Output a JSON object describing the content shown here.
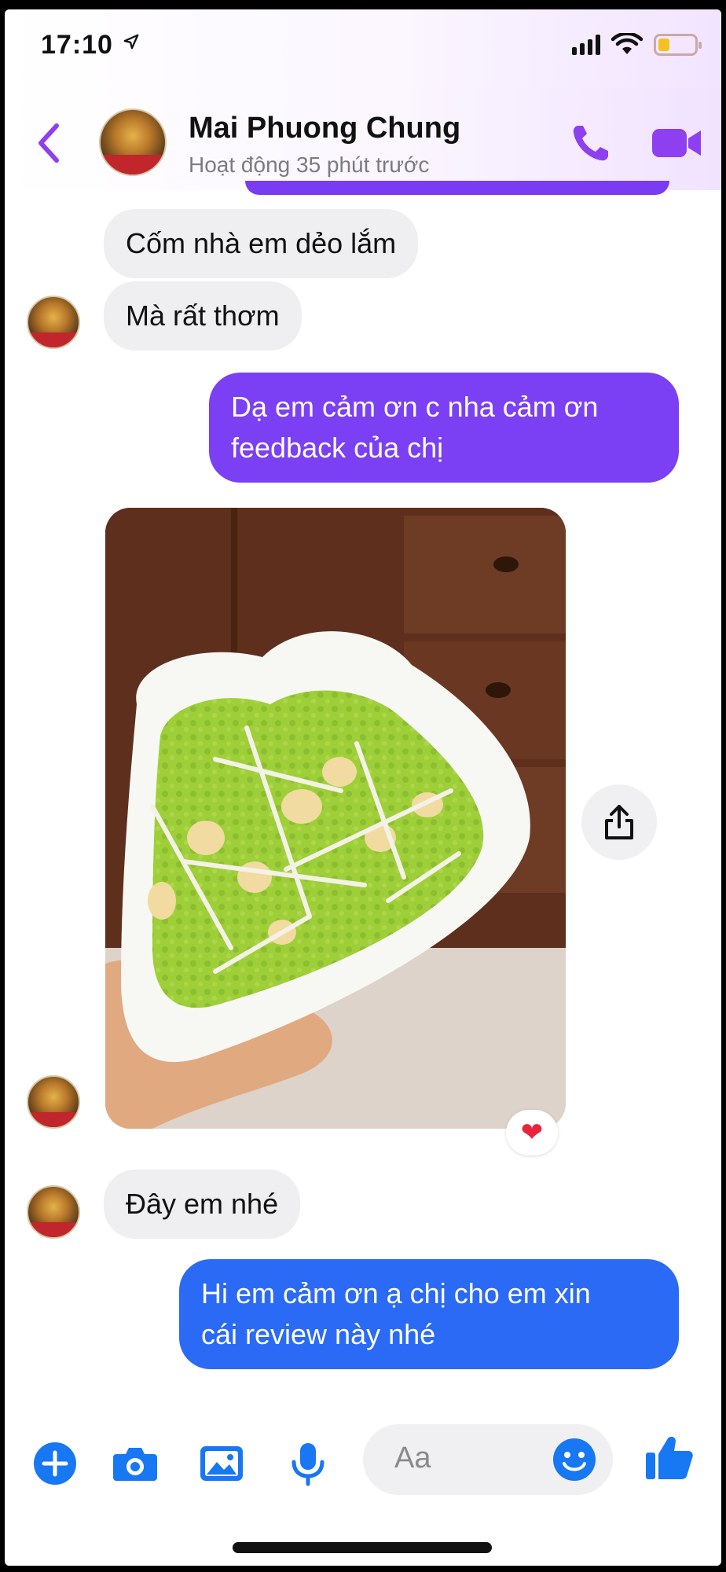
{
  "status_bar": {
    "time": "17:10"
  },
  "header": {
    "contact_name": "Mai Phuong Chung",
    "activity_status": "Hoạt động 35 phút trước"
  },
  "messages": [
    {
      "from": "contact",
      "text": "Cốm nhà em dẻo lắm"
    },
    {
      "from": "contact",
      "text": "Mà rất thơm"
    },
    {
      "from": "me",
      "line1": "Dạ em cảm ơn c nha cảm ơn",
      "line2": "feedback của chị"
    },
    {
      "from": "contact",
      "type": "photo",
      "reaction": "❤"
    },
    {
      "from": "contact",
      "text": "Đây em nhé"
    },
    {
      "from": "me",
      "line1": "Hi em cảm ơn ạ chị cho em xin",
      "line2": "cái review này nhé"
    }
  ],
  "composer": {
    "placeholder": "Aa"
  },
  "colors": {
    "accent_purple": "#7b40f3",
    "accent_blue": "#2a6af5",
    "icon_blue": "#1877f2"
  }
}
